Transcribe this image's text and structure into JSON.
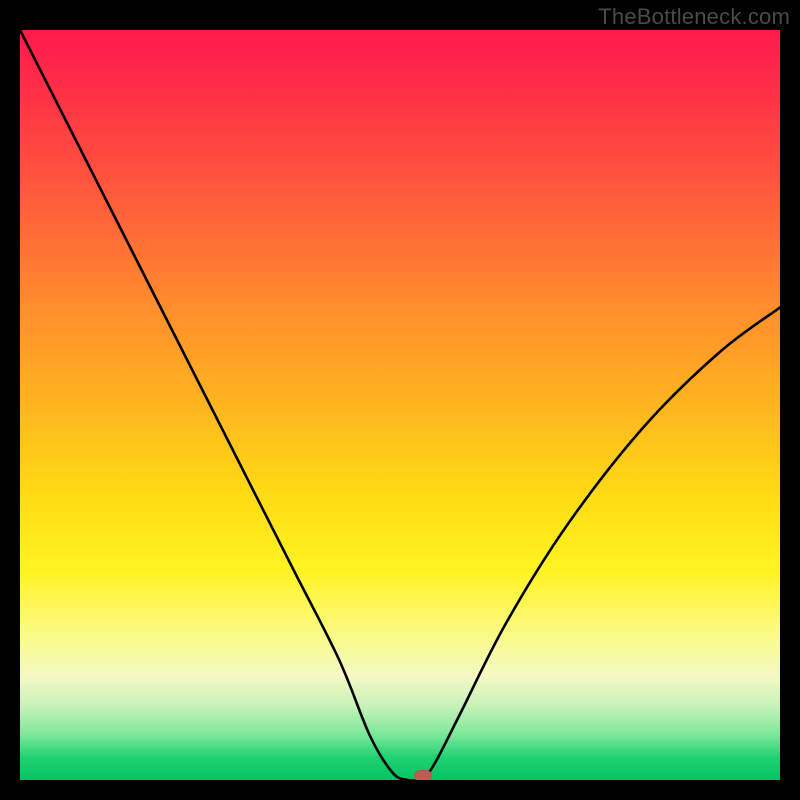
{
  "watermark": "TheBottleneck.com",
  "chart_data": {
    "type": "line",
    "title": "",
    "xlabel": "",
    "ylabel": "",
    "xlim": [
      0,
      100
    ],
    "ylim": [
      0,
      100
    ],
    "series": [
      {
        "name": "bottleneck-curve",
        "x": [
          0,
          6,
          12,
          18,
          24,
          30,
          36,
          42,
          46,
          49,
          51,
          53,
          53.5,
          55,
          58,
          64,
          72,
          82,
          92,
          100
        ],
        "values": [
          100,
          88,
          76,
          64,
          52,
          40,
          28,
          16,
          6,
          1,
          0,
          0,
          0.5,
          3,
          9,
          21,
          34,
          47,
          57,
          63
        ]
      }
    ],
    "marker": {
      "x": 53,
      "y": 0
    },
    "background_gradient": {
      "stops": [
        {
          "pos": 0,
          "color": "#ff1a4d"
        },
        {
          "pos": 22,
          "color": "#ff5a3c"
        },
        {
          "pos": 50,
          "color": "#ffb51f"
        },
        {
          "pos": 72,
          "color": "#fff321"
        },
        {
          "pos": 86,
          "color": "#f5f9c4"
        },
        {
          "pos": 94,
          "color": "#7be89a"
        },
        {
          "pos": 100,
          "color": "#06c463"
        }
      ]
    }
  }
}
